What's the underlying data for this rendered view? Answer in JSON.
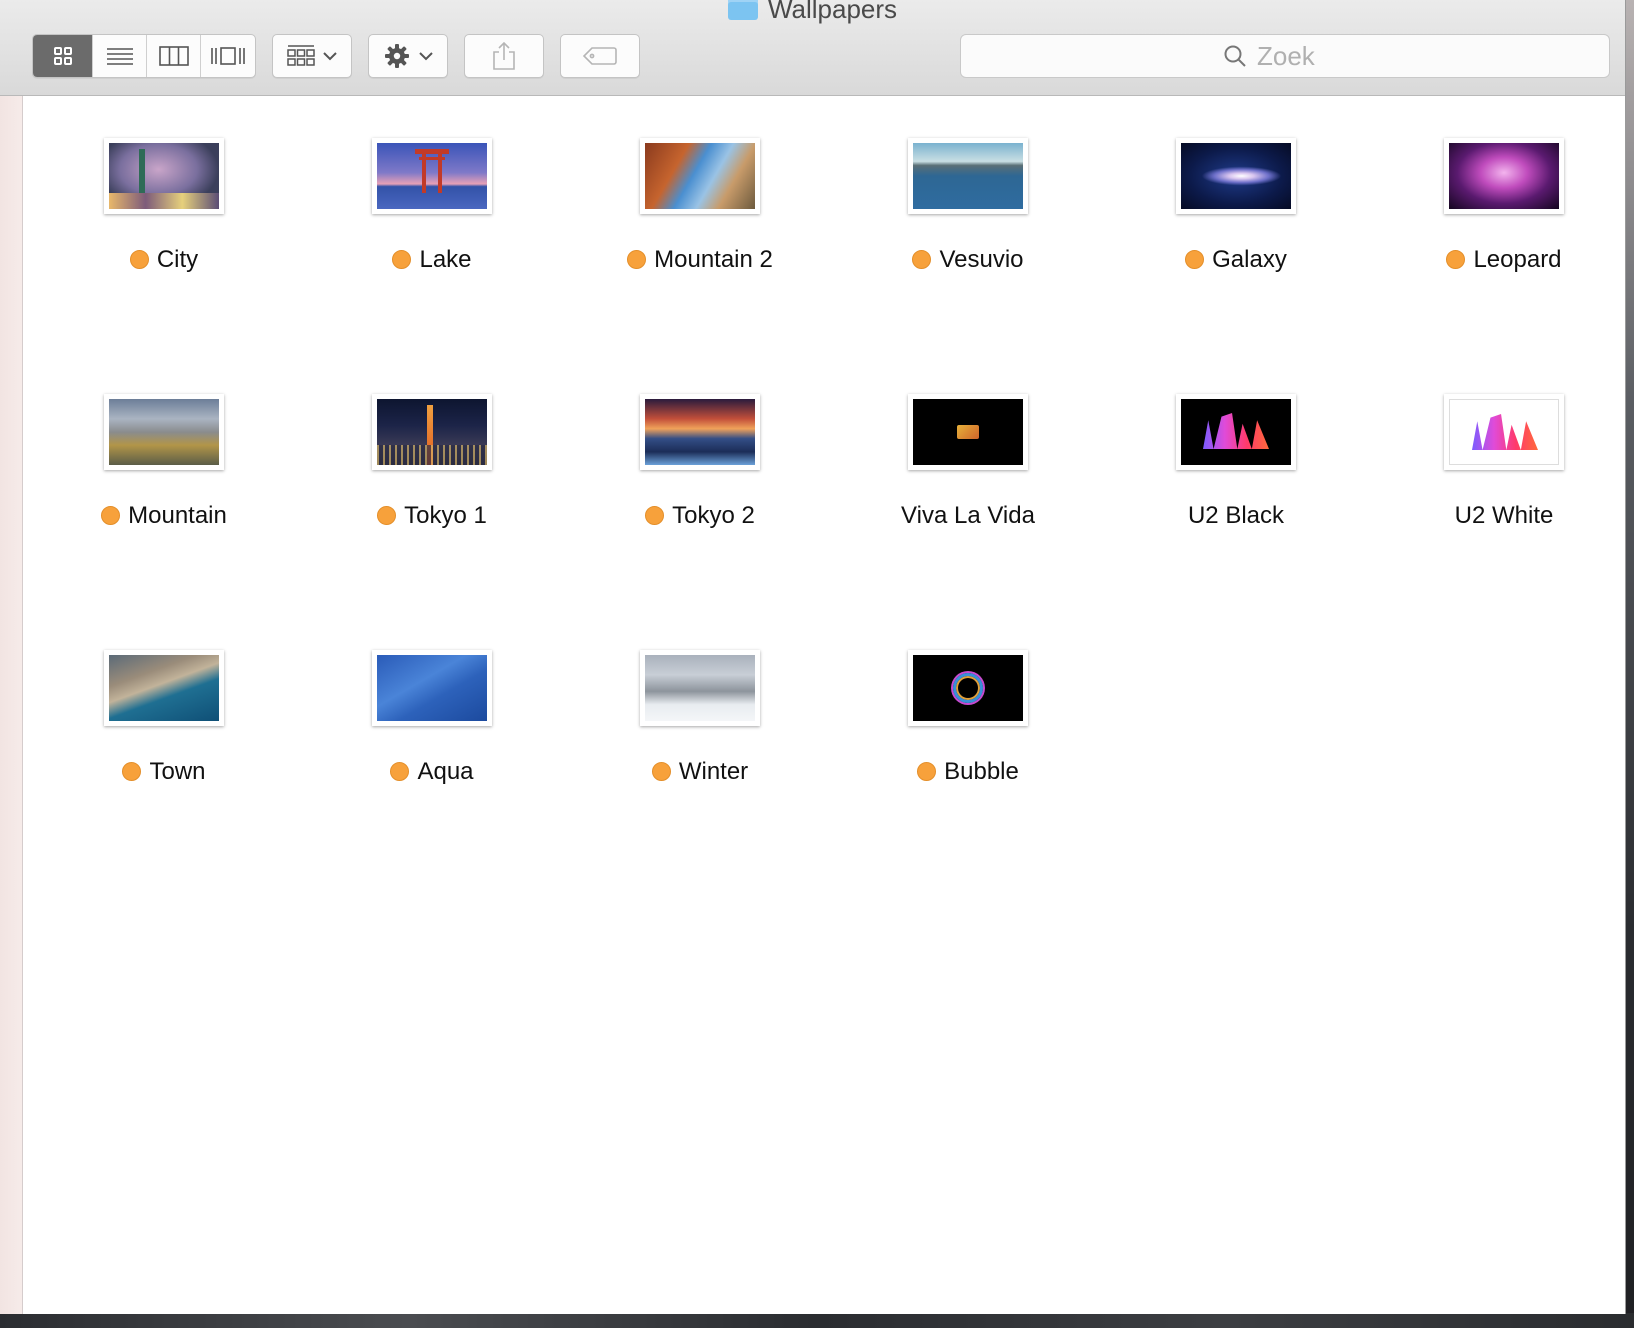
{
  "window": {
    "title": "Wallpapers"
  },
  "toolbar": {
    "view_buttons": [
      {
        "name": "icon-view-button",
        "icon": "icon-grid-icon",
        "active": true
      },
      {
        "name": "list-view-button",
        "icon": "list-icon",
        "active": false
      },
      {
        "name": "column-view-button",
        "icon": "columns-icon",
        "active": false
      },
      {
        "name": "coverflow-view-button",
        "icon": "coverflow-icon",
        "active": false
      }
    ],
    "arrange_icon": "arrange-grid-icon",
    "action_icon": "gear-icon",
    "share_icon": "share-icon",
    "tag_icon": "tag-icon"
  },
  "search": {
    "placeholder": "Zoek"
  },
  "files": [
    {
      "name": "City",
      "tagged": true
    },
    {
      "name": "Lake",
      "tagged": true
    },
    {
      "name": "Mountain 2",
      "tagged": true
    },
    {
      "name": "Vesuvio",
      "tagged": true
    },
    {
      "name": "Galaxy",
      "tagged": true
    },
    {
      "name": "Leopard",
      "tagged": true
    },
    {
      "name": "Mountain",
      "tagged": true
    },
    {
      "name": "Tokyo 1",
      "tagged": true
    },
    {
      "name": "Tokyo 2",
      "tagged": true
    },
    {
      "name": "Viva La Vida",
      "tagged": false
    },
    {
      "name": "U2 Black",
      "tagged": false
    },
    {
      "name": "U2 White",
      "tagged": false
    },
    {
      "name": "Town",
      "tagged": true
    },
    {
      "name": "Aqua",
      "tagged": true
    },
    {
      "name": "Winter",
      "tagged": true
    },
    {
      "name": "Bubble",
      "tagged": true
    }
  ],
  "colors": {
    "tag_orange": "#f7a13b",
    "active_segment": "#6b6b6b",
    "folder_blue": "#7cc4f1"
  }
}
